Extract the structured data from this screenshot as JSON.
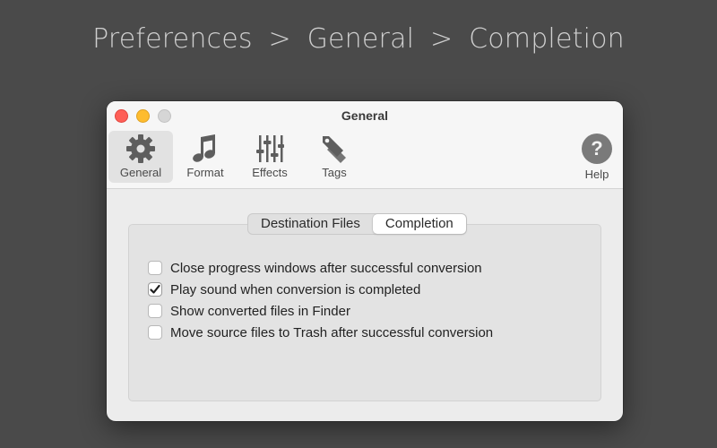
{
  "heading": {
    "part1": "Preferences",
    "sep1": ">",
    "part2": "General",
    "sep2": ">",
    "part3": "Completion"
  },
  "window": {
    "title": "General"
  },
  "toolbar": {
    "items": [
      {
        "label": "General",
        "icon": "gear-icon",
        "selected": true
      },
      {
        "label": "Format",
        "icon": "music-note-icon",
        "selected": false
      },
      {
        "label": "Effects",
        "icon": "sliders-icon",
        "selected": false
      },
      {
        "label": "Tags",
        "icon": "tag-icon",
        "selected": false
      }
    ],
    "help": {
      "label": "Help",
      "icon_glyph": "?"
    }
  },
  "tabs": {
    "items": [
      {
        "label": "Destination Files",
        "active": false
      },
      {
        "label": "Completion",
        "active": true
      }
    ]
  },
  "options": [
    {
      "label": "Close progress windows after successful conversion",
      "checked": false
    },
    {
      "label": "Play sound when conversion is completed",
      "checked": true
    },
    {
      "label": "Show converted files in Finder",
      "checked": false
    },
    {
      "label": "Move source files to Trash after successful conversion",
      "checked": false
    }
  ],
  "colors": {
    "background": "#4a4a4a",
    "window": "#ececec",
    "close": "#fe5f57",
    "minimize": "#febc2e",
    "zoom": "#d6d6d6"
  }
}
